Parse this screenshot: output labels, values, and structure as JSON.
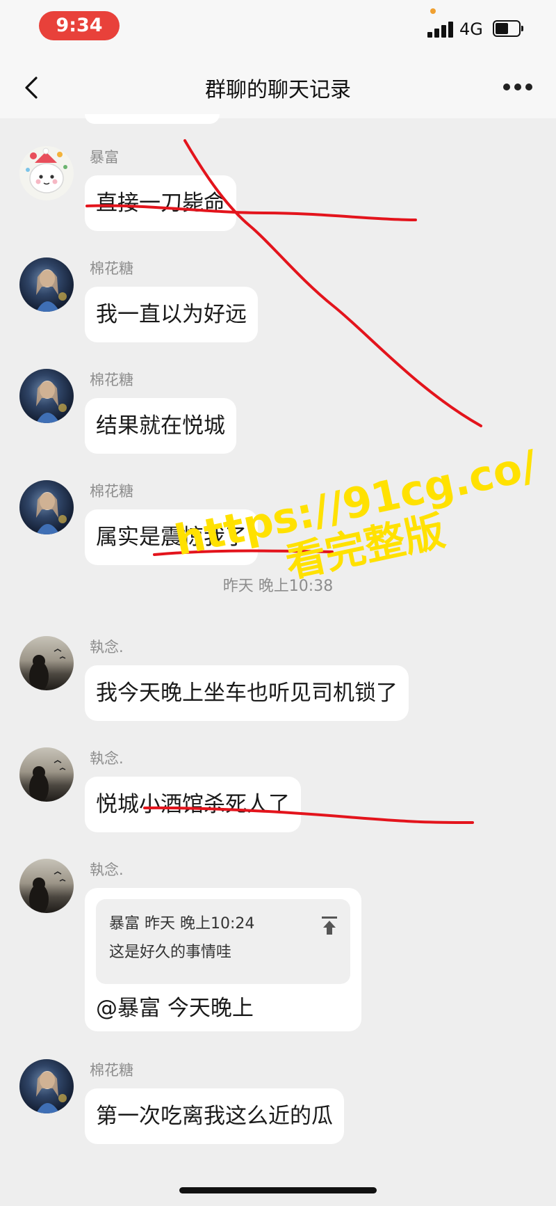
{
  "status": {
    "time": "9:34",
    "network": "4G",
    "icons": [
      "signal-icon",
      "battery-icon"
    ]
  },
  "nav": {
    "title": "群聊的聊天记录",
    "icons": [
      "back-icon",
      "more-icon"
    ]
  },
  "messages": [
    {
      "sender": "暴富",
      "text": "直接一刀毙命",
      "avatar": "cat-avatar"
    },
    {
      "sender": "棉花糖",
      "text": "我一直以为好远",
      "avatar": "girl-avatar"
    },
    {
      "sender": "棉花糖",
      "text": "结果就在悦城",
      "avatar": "girl-avatar"
    },
    {
      "sender": "棉花糖",
      "text": "属实是震惊我了",
      "avatar": "girl-avatar"
    },
    {
      "sender": "執念.",
      "text": "我今天晚上坐车也听见司机锁了",
      "avatar": "night-avatar"
    },
    {
      "sender": "執念.",
      "text": "悦城小酒馆杀死人了",
      "avatar": "night-avatar"
    },
    {
      "sender": "執念.",
      "avatar": "night-avatar",
      "quote": {
        "meta": "暴富  昨天 晚上10:24",
        "text": "这是好久的事情哇"
      },
      "text": "@暴富  今天晚上"
    },
    {
      "sender": "棉花糖",
      "text": "第一次吃离我这么近的瓜",
      "avatar": "girl-avatar"
    }
  ],
  "timestamp": "昨天 晚上10:38",
  "watermark": {
    "line1": "https://91cg.co/",
    "line2": "看完整版",
    "color": "#ffe100"
  },
  "annotation_color": "#e3141c"
}
